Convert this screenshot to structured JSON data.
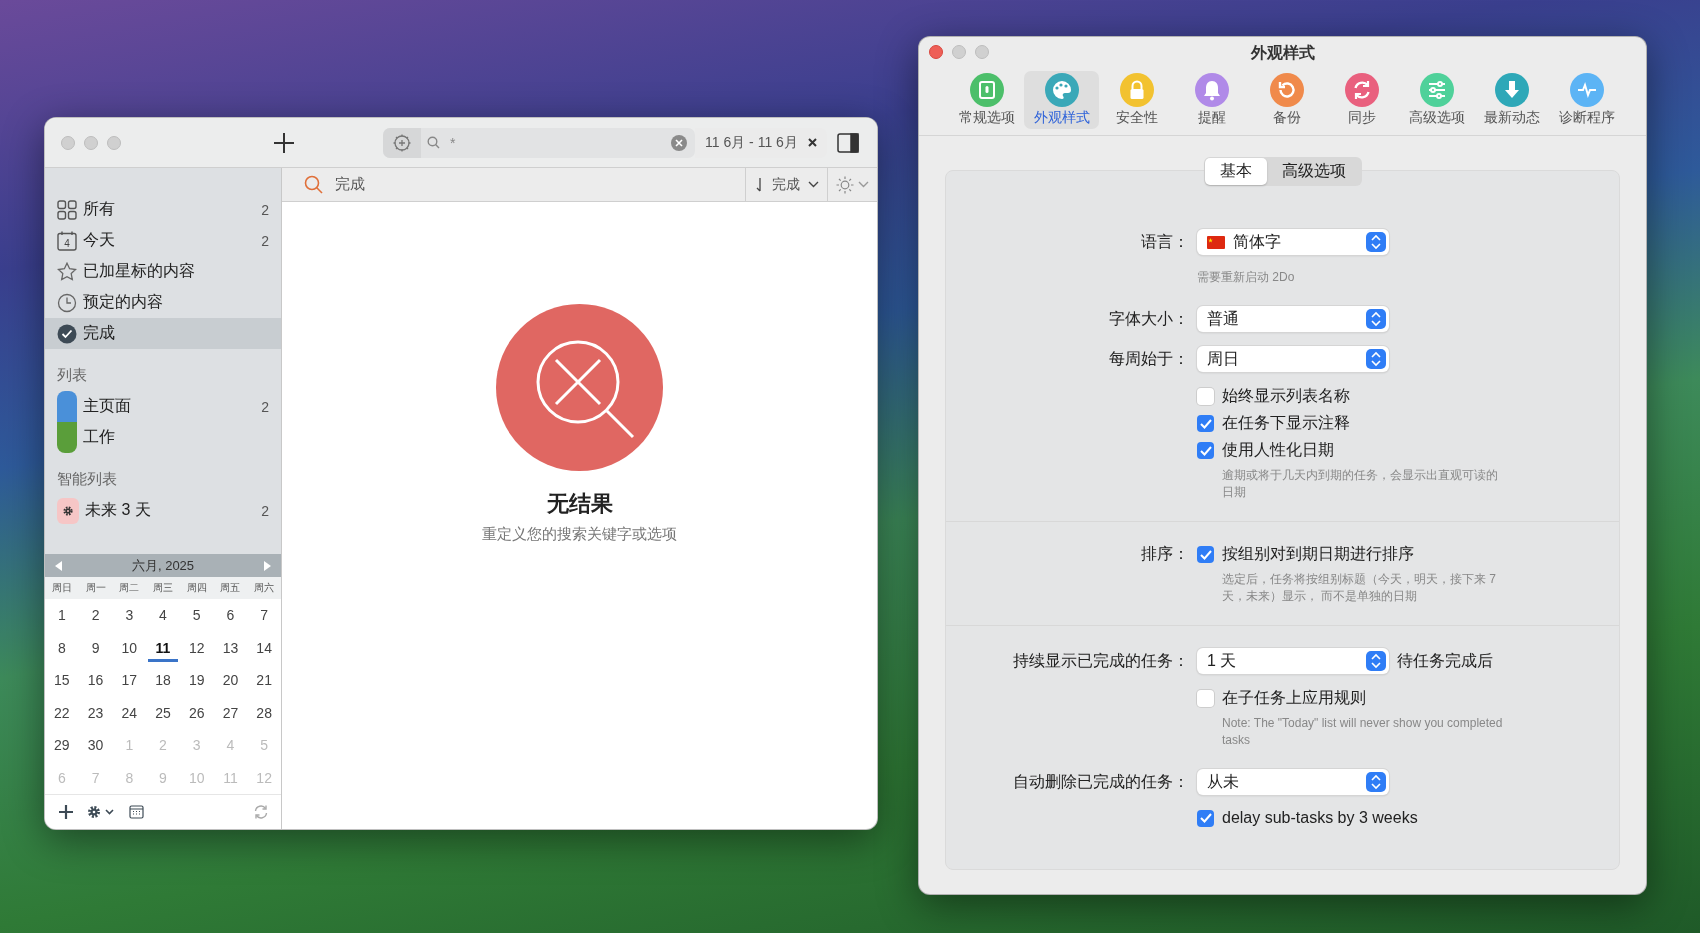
{
  "left_window": {
    "toolbar": {
      "search_query": "*",
      "date_range": "11 6月 - 11 6月"
    },
    "filter_bar": {
      "query": "完成",
      "sort_label": "完成"
    },
    "sidebar": {
      "items": [
        {
          "kind": "all",
          "label": "所有",
          "count": "2",
          "selected": false
        },
        {
          "kind": "today",
          "label": "今天",
          "count": "2",
          "icon_text": "4",
          "selected": false
        },
        {
          "kind": "starred",
          "label": "已加星标的内容",
          "selected": false
        },
        {
          "kind": "scheduled",
          "label": "预定的内容",
          "selected": false
        },
        {
          "kind": "done",
          "label": "完成",
          "selected": true
        }
      ],
      "lists_heading": "列表",
      "lists": [
        {
          "label": "主页面",
          "count": "2",
          "color": "#4a90d9"
        },
        {
          "label": "工作",
          "color": "#5a9e3a"
        }
      ],
      "smart_heading": "智能列表",
      "smart_lists": [
        {
          "label": "未来 3 天",
          "count": "2"
        }
      ]
    },
    "calendar": {
      "title": "六月, 2025",
      "weekdays": [
        "周日",
        "周一",
        "周二",
        "周三",
        "周四",
        "周五",
        "周六"
      ],
      "weeks": [
        [
          {
            "day": "1",
            "in_month": true,
            "today": false
          },
          {
            "day": "2",
            "in_month": true,
            "today": false
          },
          {
            "day": "3",
            "in_month": true,
            "today": false
          },
          {
            "day": "4",
            "in_month": true,
            "today": false
          },
          {
            "day": "5",
            "in_month": true,
            "today": false
          },
          {
            "day": "6",
            "in_month": true,
            "today": false
          },
          {
            "day": "7",
            "in_month": true,
            "today": false
          }
        ],
        [
          {
            "day": "8",
            "in_month": true,
            "today": false
          },
          {
            "day": "9",
            "in_month": true,
            "today": false
          },
          {
            "day": "10",
            "in_month": true,
            "today": false
          },
          {
            "day": "11",
            "in_month": true,
            "today": true
          },
          {
            "day": "12",
            "in_month": true,
            "today": false
          },
          {
            "day": "13",
            "in_month": true,
            "today": false
          },
          {
            "day": "14",
            "in_month": true,
            "today": false
          }
        ],
        [
          {
            "day": "15",
            "in_month": true,
            "today": false
          },
          {
            "day": "16",
            "in_month": true,
            "today": false
          },
          {
            "day": "17",
            "in_month": true,
            "today": false
          },
          {
            "day": "18",
            "in_month": true,
            "today": false
          },
          {
            "day": "19",
            "in_month": true,
            "today": false
          },
          {
            "day": "20",
            "in_month": true,
            "today": false
          },
          {
            "day": "21",
            "in_month": true,
            "today": false
          }
        ],
        [
          {
            "day": "22",
            "in_month": true,
            "today": false
          },
          {
            "day": "23",
            "in_month": true,
            "today": false
          },
          {
            "day": "24",
            "in_month": true,
            "today": false
          },
          {
            "day": "25",
            "in_month": true,
            "today": false
          },
          {
            "day": "26",
            "in_month": true,
            "today": false
          },
          {
            "day": "27",
            "in_month": true,
            "today": false
          },
          {
            "day": "28",
            "in_month": true,
            "today": false
          }
        ],
        [
          {
            "day": "29",
            "in_month": true,
            "today": false
          },
          {
            "day": "30",
            "in_month": true,
            "today": false
          },
          {
            "day": "1",
            "in_month": false,
            "today": false
          },
          {
            "day": "2",
            "in_month": false,
            "today": false
          },
          {
            "day": "3",
            "in_month": false,
            "today": false
          },
          {
            "day": "4",
            "in_month": false,
            "today": false
          },
          {
            "day": "5",
            "in_month": false,
            "today": false
          }
        ],
        [
          {
            "day": "6",
            "in_month": false,
            "today": false
          },
          {
            "day": "7",
            "in_month": false,
            "today": false
          },
          {
            "day": "8",
            "in_month": false,
            "today": false
          },
          {
            "day": "9",
            "in_month": false,
            "today": false
          },
          {
            "day": "10",
            "in_month": false,
            "today": false
          },
          {
            "day": "11",
            "in_month": false,
            "today": false
          },
          {
            "day": "12",
            "in_month": false,
            "today": false
          }
        ]
      ]
    },
    "empty_state": {
      "title": "无结果",
      "subtitle": "重定义您的搜索关键字或选项"
    }
  },
  "prefs_window": {
    "title": "外观样式",
    "tabs": [
      {
        "kind": "general",
        "label": "常规选项",
        "color": "#4cbf6a",
        "selected": false
      },
      {
        "kind": "appearance",
        "label": "外观样式",
        "color": "#3aa8b8",
        "selected": true
      },
      {
        "kind": "security",
        "label": "安全性",
        "color": "#f2c230",
        "selected": false
      },
      {
        "kind": "reminders",
        "label": "提醒",
        "color": "#b08ae8",
        "selected": false
      },
      {
        "kind": "backup",
        "label": "备份",
        "color": "#f08a4b",
        "selected": false
      },
      {
        "kind": "sync",
        "label": "同步",
        "color": "#e9607e",
        "selected": false
      },
      {
        "kind": "advanced",
        "label": "高级选项",
        "color": "#4fd19a",
        "selected": false
      },
      {
        "kind": "news",
        "label": "最新动态",
        "color": "#2ea8b8",
        "selected": false
      },
      {
        "kind": "diagnostics",
        "label": "诊断程序",
        "color": "#5cb4f5",
        "selected": false
      }
    ],
    "segments": [
      {
        "label": "基本",
        "selected": true
      },
      {
        "label": "高级选项",
        "selected": false
      }
    ],
    "rows": [
      {
        "kind": "select",
        "label": "语言：",
        "value": "简体字",
        "flag": true
      },
      {
        "kind": "note",
        "text": "需要重新启动 2Do",
        "indent": false
      },
      {
        "kind": "select",
        "label": "字体大小：",
        "value": "普通"
      },
      {
        "kind": "select",
        "label": "每周始于：",
        "value": "周日"
      },
      {
        "kind": "checkbox",
        "text": "始终显示列表名称",
        "checked": false
      },
      {
        "kind": "checkbox",
        "text": "在任务下显示注释",
        "checked": true
      },
      {
        "kind": "checkbox",
        "text": "使用人性化日期",
        "checked": true
      },
      {
        "kind": "note",
        "text": "逾期或将于几天内到期的任务，会显示出直观可读的日期",
        "indent": true
      },
      {
        "kind": "divider"
      },
      {
        "kind": "checkbox",
        "label": "排序：",
        "text": "按组别对到期日期进行排序",
        "checked": true
      },
      {
        "kind": "note",
        "text": "选定后，任务将按组别标题（今天，明天，接下来 7 天，未来）显示， 而不是单独的日期",
        "indent": true
      },
      {
        "kind": "divider"
      },
      {
        "kind": "select",
        "label": "持续显示已完成的任务：",
        "value": "1 天",
        "suffix": "待任务完成后"
      },
      {
        "kind": "checkbox",
        "text": "在子任务上应用规则",
        "checked": false
      },
      {
        "kind": "note",
        "text": "Note: The \"Today\" list will never show you completed tasks",
        "indent": true
      },
      {
        "kind": "select",
        "label": "自动删除已完成的任务：",
        "value": "从未"
      },
      {
        "kind": "checkbox",
        "text": "delay sub-tasks by 3 weeks",
        "checked": true
      }
    ]
  }
}
